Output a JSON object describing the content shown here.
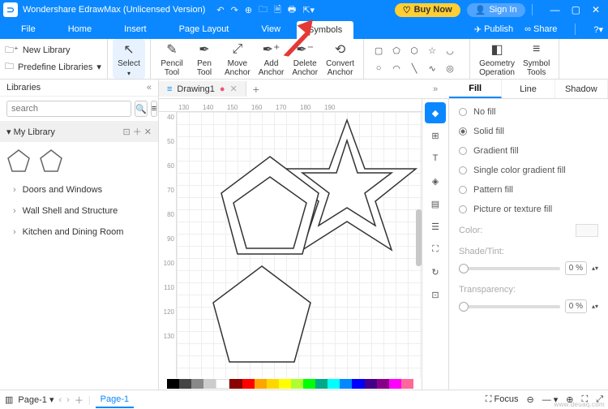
{
  "titlebar": {
    "app_title": "Wondershare EdrawMax (Unlicensed Version)",
    "buy_label": "Buy Now",
    "signin_label": "Sign In"
  },
  "menubar": {
    "items": [
      "File",
      "Home",
      "Insert",
      "Page Layout",
      "View",
      "Symbols"
    ],
    "publish": "Publish",
    "share": "Share"
  },
  "ribbon": {
    "new_library": "New Library",
    "predefine": "Predefine Libraries",
    "select": "Select",
    "pencil": "Pencil\nTool",
    "pen": "Pen\nTool",
    "move": "Move\nAnchor",
    "add": "Add\nAnchor",
    "delete": "Delete\nAnchor",
    "convert": "Convert\nAnchor",
    "geometry": "Geometry\nOperation",
    "symbol_tools": "Symbol\nTools"
  },
  "left": {
    "libraries": "Libraries",
    "search_placeholder": "search",
    "mylib": "My Library",
    "cats": [
      "Doors and Windows",
      "Wall Shell and Structure",
      "Kitchen and Dining Room"
    ]
  },
  "doc": {
    "tab_name": "Drawing1",
    "add_tab": "+",
    "ruler_h": [
      "130",
      "140",
      "150",
      "160",
      "170",
      "180",
      "190"
    ],
    "ruler_v": [
      "40",
      "50",
      "60",
      "70",
      "80",
      "90",
      "100",
      "110",
      "120",
      "130"
    ]
  },
  "right": {
    "tabs": [
      "Fill",
      "Line",
      "Shadow"
    ],
    "opts": [
      "No fill",
      "Solid fill",
      "Gradient fill",
      "Single color gradient fill",
      "Pattern fill",
      "Picture or texture fill"
    ],
    "color_label": "Color:",
    "shade_label": "Shade/Tint:",
    "transp_label": "Transparency:",
    "pct": "0 %"
  },
  "status": {
    "page_label": "Page-1",
    "page_tab": "Page-1",
    "focus": "Focus",
    "zoom": "—"
  }
}
